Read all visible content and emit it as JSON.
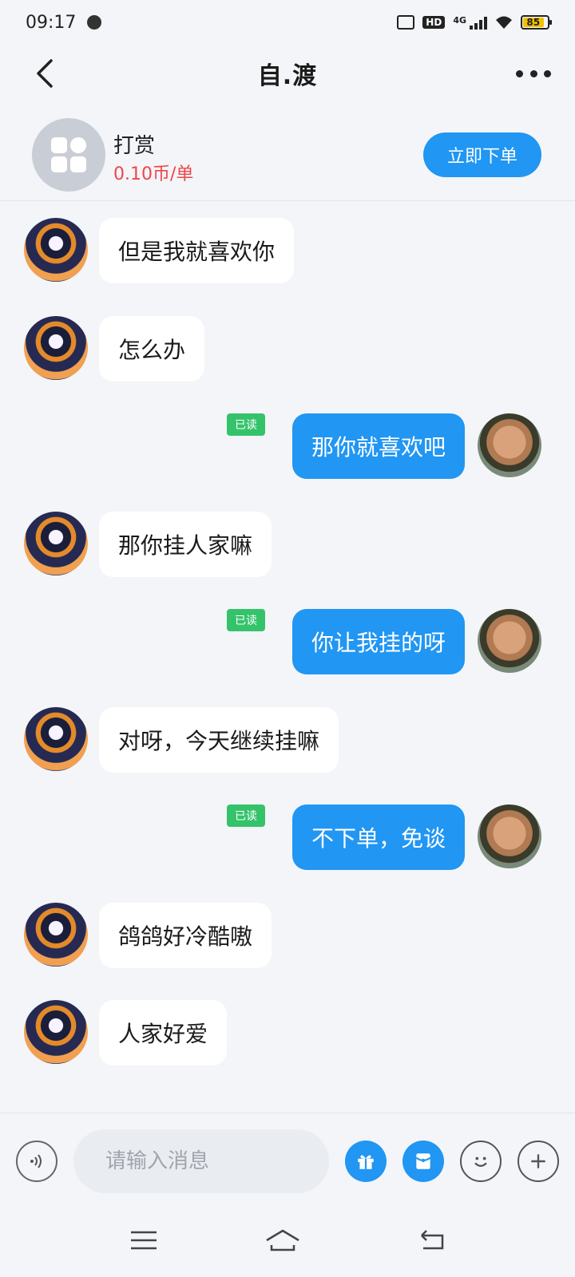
{
  "status_bar": {
    "time": "09:17",
    "network": "4G",
    "hd": "HD",
    "battery": "85"
  },
  "header": {
    "title": "自.渡"
  },
  "service": {
    "name": "打赏",
    "price": "0.10币/单",
    "order_button": "立即下单"
  },
  "read_label": "已读",
  "messages": [
    {
      "from": "other",
      "text": "但是我就喜欢你"
    },
    {
      "from": "other",
      "text": "怎么办"
    },
    {
      "from": "me",
      "text": "那你就喜欢吧",
      "status": "已读"
    },
    {
      "from": "other",
      "text": "那你挂人家嘛"
    },
    {
      "from": "me",
      "text": "你让我挂的呀",
      "status": "已读"
    },
    {
      "from": "other",
      "text": "对呀，今天继续挂嘛"
    },
    {
      "from": "me",
      "text": "不下单，免谈",
      "status": "已读"
    },
    {
      "from": "other",
      "text": "鸽鸽好冷酷嗷"
    },
    {
      "from": "other",
      "text": "人家好爱"
    }
  ],
  "input": {
    "placeholder": "请输入消息"
  },
  "colors": {
    "accent": "#2196f3",
    "price": "#f0454a",
    "read_badge": "#34c36b",
    "background": "#f3f5f8"
  },
  "icons": [
    "back-arrow-icon",
    "more-dots-icon",
    "grid-apps-icon",
    "voice-icon",
    "gift-icon",
    "red-packet-icon",
    "emoji-icon",
    "plus-icon",
    "menu-icon",
    "home-icon",
    "return-icon"
  ]
}
